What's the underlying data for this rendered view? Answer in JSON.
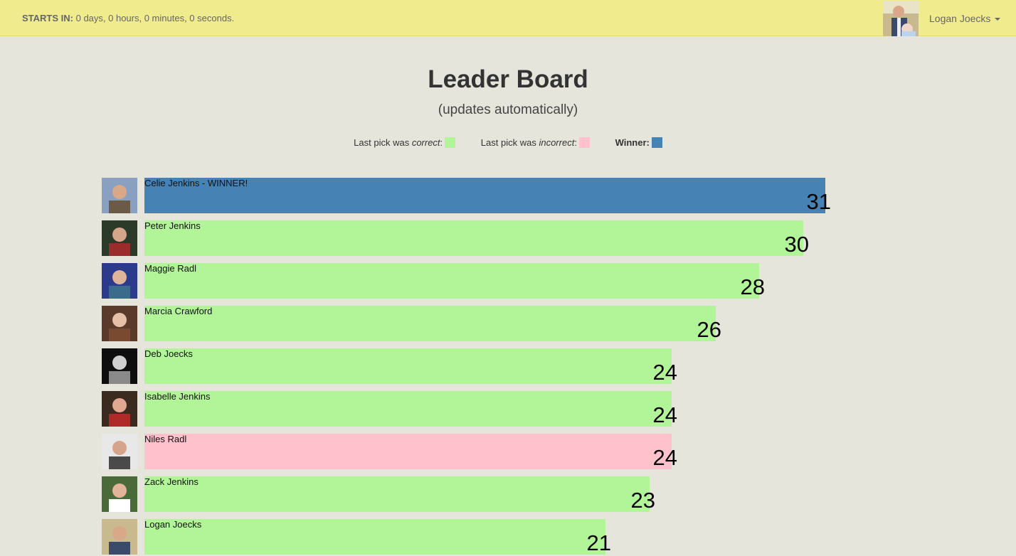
{
  "topbar": {
    "countdown_label": "STARTS IN:",
    "countdown_value": "0 days, 0 hours, 0 minutes, 0 seconds.",
    "user_name": "Logan Joecks"
  },
  "page": {
    "title": "Leader Board",
    "subtitle": "(updates automatically)"
  },
  "legend": {
    "correct_prefix": "Last pick was ",
    "correct_em": "correct",
    "incorrect_prefix": "Last pick was ",
    "incorrect_em": "incorrect",
    "winner_label": "Winner:",
    "colors": {
      "correct": "#b2f598",
      "incorrect": "#ffc2cc",
      "winner": "#4682b4"
    }
  },
  "leaderboard": {
    "max_score": 31,
    "entries": [
      {
        "name": "Celie Jenkins - WINNER!",
        "score": 31,
        "status": "winner",
        "avatar": "avatar-photo"
      },
      {
        "name": "Peter Jenkins",
        "score": 30,
        "status": "correct",
        "avatar": "avatar-photo"
      },
      {
        "name": "Maggie Radl",
        "score": 28,
        "status": "correct",
        "avatar": "avatar-photo"
      },
      {
        "name": "Marcia Crawford",
        "score": 26,
        "status": "correct",
        "avatar": "avatar-photo"
      },
      {
        "name": "Deb Joecks",
        "score": 24,
        "status": "correct",
        "avatar": "avatar-photo"
      },
      {
        "name": "Isabelle Jenkins",
        "score": 24,
        "status": "correct",
        "avatar": "avatar-photo"
      },
      {
        "name": "Niles Radl",
        "score": 24,
        "status": "incorrect",
        "avatar": "avatar-photo"
      },
      {
        "name": "Zack Jenkins",
        "score": 23,
        "status": "correct",
        "avatar": "avatar-photo"
      },
      {
        "name": "Logan Joecks",
        "score": 21,
        "status": "correct",
        "avatar": "avatar-photo"
      }
    ]
  }
}
